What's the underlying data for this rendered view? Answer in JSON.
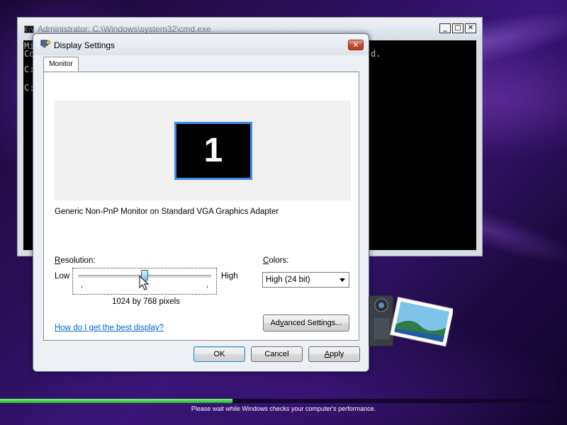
{
  "cmd": {
    "title": "Administrator: C:\\Windows\\system32\\cmd.exe",
    "icon": "console-icon",
    "lines": [
      "Mi",
      "Co",
      "C:",
      "C:"
    ],
    "tail_text": "d.",
    "controls": {
      "minimize": "_",
      "maximize": "□",
      "close": "✕"
    }
  },
  "dialog": {
    "title": "Display Settings",
    "icon": "display-settings-icon",
    "close_glyph": "✕",
    "tab": "Monitor",
    "monitor_number": "1",
    "monitor_description": "Generic Non-PnP Monitor on Standard VGA Graphics Adapter",
    "resolution": {
      "label_accel": "R",
      "label_rest": "esolution:",
      "low": "Low",
      "high": "High",
      "value": "1024 by 768 pixels",
      "slider_position": 0.5
    },
    "colors": {
      "label_accel": "C",
      "label_rest": "olors:",
      "selected": "High (24 bit)"
    },
    "help_link": "How do I get the best display?",
    "advanced_button": {
      "pre": "Ad",
      "accel": "v",
      "post": "anced Settings..."
    },
    "ok": "OK",
    "cancel": "Cancel",
    "apply_accel": "A",
    "apply_rest": "pply"
  },
  "desktop": {
    "status_text": "Please wait while Windows checks your computer's performance.",
    "progress": 0.41,
    "accent_colors": {
      "progress": "#1fae2b",
      "link": "#0066cc",
      "monitor_border": "#3d8ee6"
    }
  }
}
